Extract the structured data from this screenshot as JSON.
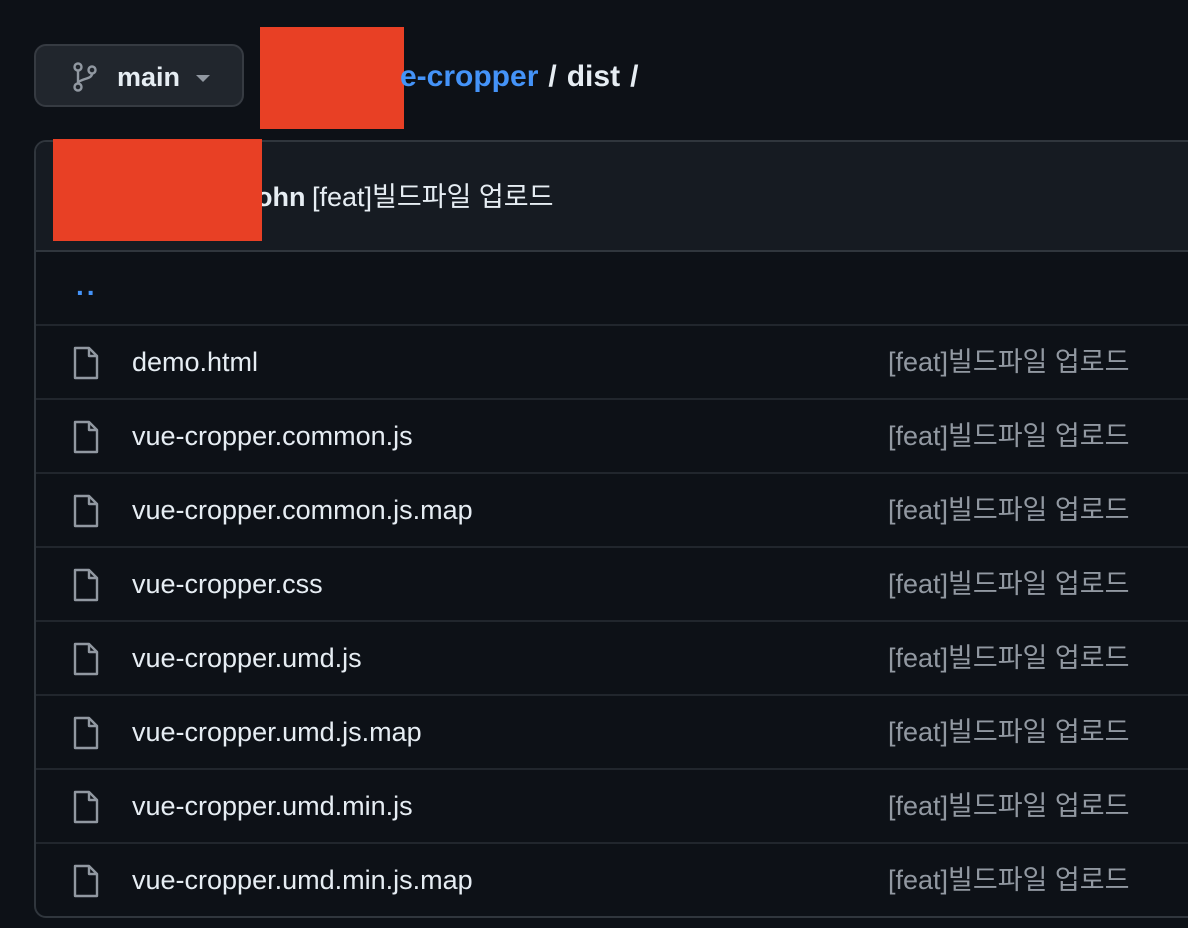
{
  "branch": {
    "label": "main",
    "icon": "git-branch-icon"
  },
  "breadcrumb": {
    "repo": "e-cropper",
    "separator_1": "/",
    "current": "dist",
    "separator_2": "/"
  },
  "commit": {
    "author": "ohn",
    "message": "[feat]빌드파일 업로드"
  },
  "parent_link": "..",
  "files": [
    {
      "name": "demo.html",
      "commit": "[feat]빌드파일 업로드",
      "icon": "file-icon"
    },
    {
      "name": "vue-cropper.common.js",
      "commit": "[feat]빌드파일 업로드",
      "icon": "file-icon"
    },
    {
      "name": "vue-cropper.common.js.map",
      "commit": "[feat]빌드파일 업로드",
      "icon": "file-icon"
    },
    {
      "name": "vue-cropper.css",
      "commit": "[feat]빌드파일 업로드",
      "icon": "file-icon"
    },
    {
      "name": "vue-cropper.umd.js",
      "commit": "[feat]빌드파일 업로드",
      "icon": "file-icon"
    },
    {
      "name": "vue-cropper.umd.js.map",
      "commit": "[feat]빌드파일 업로드",
      "icon": "file-icon"
    },
    {
      "name": "vue-cropper.umd.min.js",
      "commit": "[feat]빌드파일 업로드",
      "icon": "file-icon"
    },
    {
      "name": "vue-cropper.umd.min.js.map",
      "commit": "[feat]빌드파일 업로드",
      "icon": "file-icon"
    }
  ],
  "colors": {
    "background": "#0d1117",
    "link": "#4493f8",
    "muted_text": "#9198a1",
    "redaction": "#e84025"
  }
}
